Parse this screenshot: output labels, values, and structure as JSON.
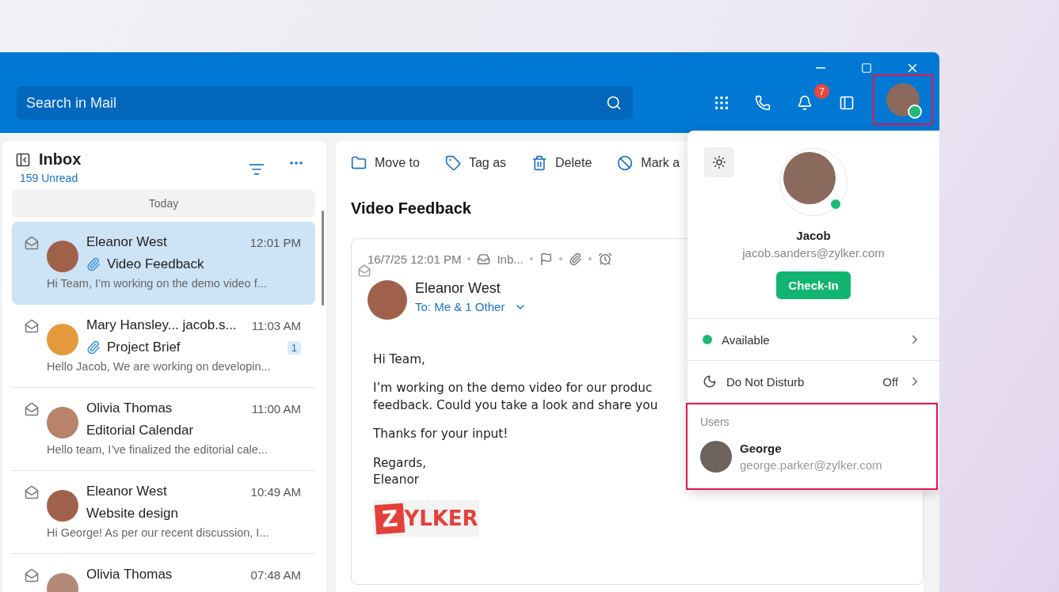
{
  "window_controls": {
    "badge_count": "7"
  },
  "search": {
    "placeholder": "Search in Mail"
  },
  "mail_list": {
    "title": "Inbox",
    "unread": "159 Unread",
    "group": "Today",
    "items": [
      {
        "sender": "Eleanor West",
        "time": "12:01 PM",
        "subject": "Video Feedback",
        "preview": "Hi Team, I’m working on the demo video f...",
        "attachment": true,
        "selected": true
      },
      {
        "sender": "Mary Hansley... jacob.s...",
        "time": "11:03 AM",
        "subject": "Project Brief",
        "preview": "Hello Jacob, We are working on developin...",
        "attachment": true,
        "count": "1",
        "selected": false
      },
      {
        "sender": "Olivia Thomas",
        "time": "11:00 AM",
        "subject": "Editorial Calendar",
        "preview": "Hello team, I’ve finalized the editorial cale...",
        "attachment": false,
        "selected": false
      },
      {
        "sender": "Eleanor West",
        "time": "10:49 AM",
        "subject": "Website design",
        "preview": "Hi George! As per our recent discussion, I...",
        "attachment": false,
        "selected": false
      },
      {
        "sender": "Olivia Thomas",
        "time": "07:48 AM",
        "selected": false
      }
    ]
  },
  "toolbar": [
    {
      "kind": "move",
      "label": "Move to"
    },
    {
      "kind": "tag",
      "label": "Tag as"
    },
    {
      "kind": "delete",
      "label": "Delete"
    },
    {
      "kind": "mark",
      "label": "Mark a"
    }
  ],
  "message": {
    "subject": "Video Feedback",
    "date": "16/7/25 12:01 PM",
    "folder": "Inb...",
    "sender": "Eleanor West",
    "recipients": "To: Me & 1 Other",
    "body": [
      [
        "Hi Team,"
      ],
      [
        "I’m working on the demo video for our produc",
        "feedback. Could you take a look and share you"
      ],
      [
        "Thanks for your input!"
      ],
      [
        "Regards,",
        "Eleanor"
      ]
    ],
    "logo": {
      "mark": "Z",
      "word": "YLKER"
    }
  },
  "profile": {
    "name": "Jacob",
    "email": "jacob.sanders@zylker.com",
    "button": "Check-In",
    "status": {
      "label": "Available",
      "color": "#1fb877"
    },
    "dnd": {
      "label": "Do Not Disturb",
      "value": "Off"
    },
    "users_title": "Users",
    "users": [
      {
        "name": "George",
        "email": "george.parker@zylker.com"
      }
    ]
  }
}
